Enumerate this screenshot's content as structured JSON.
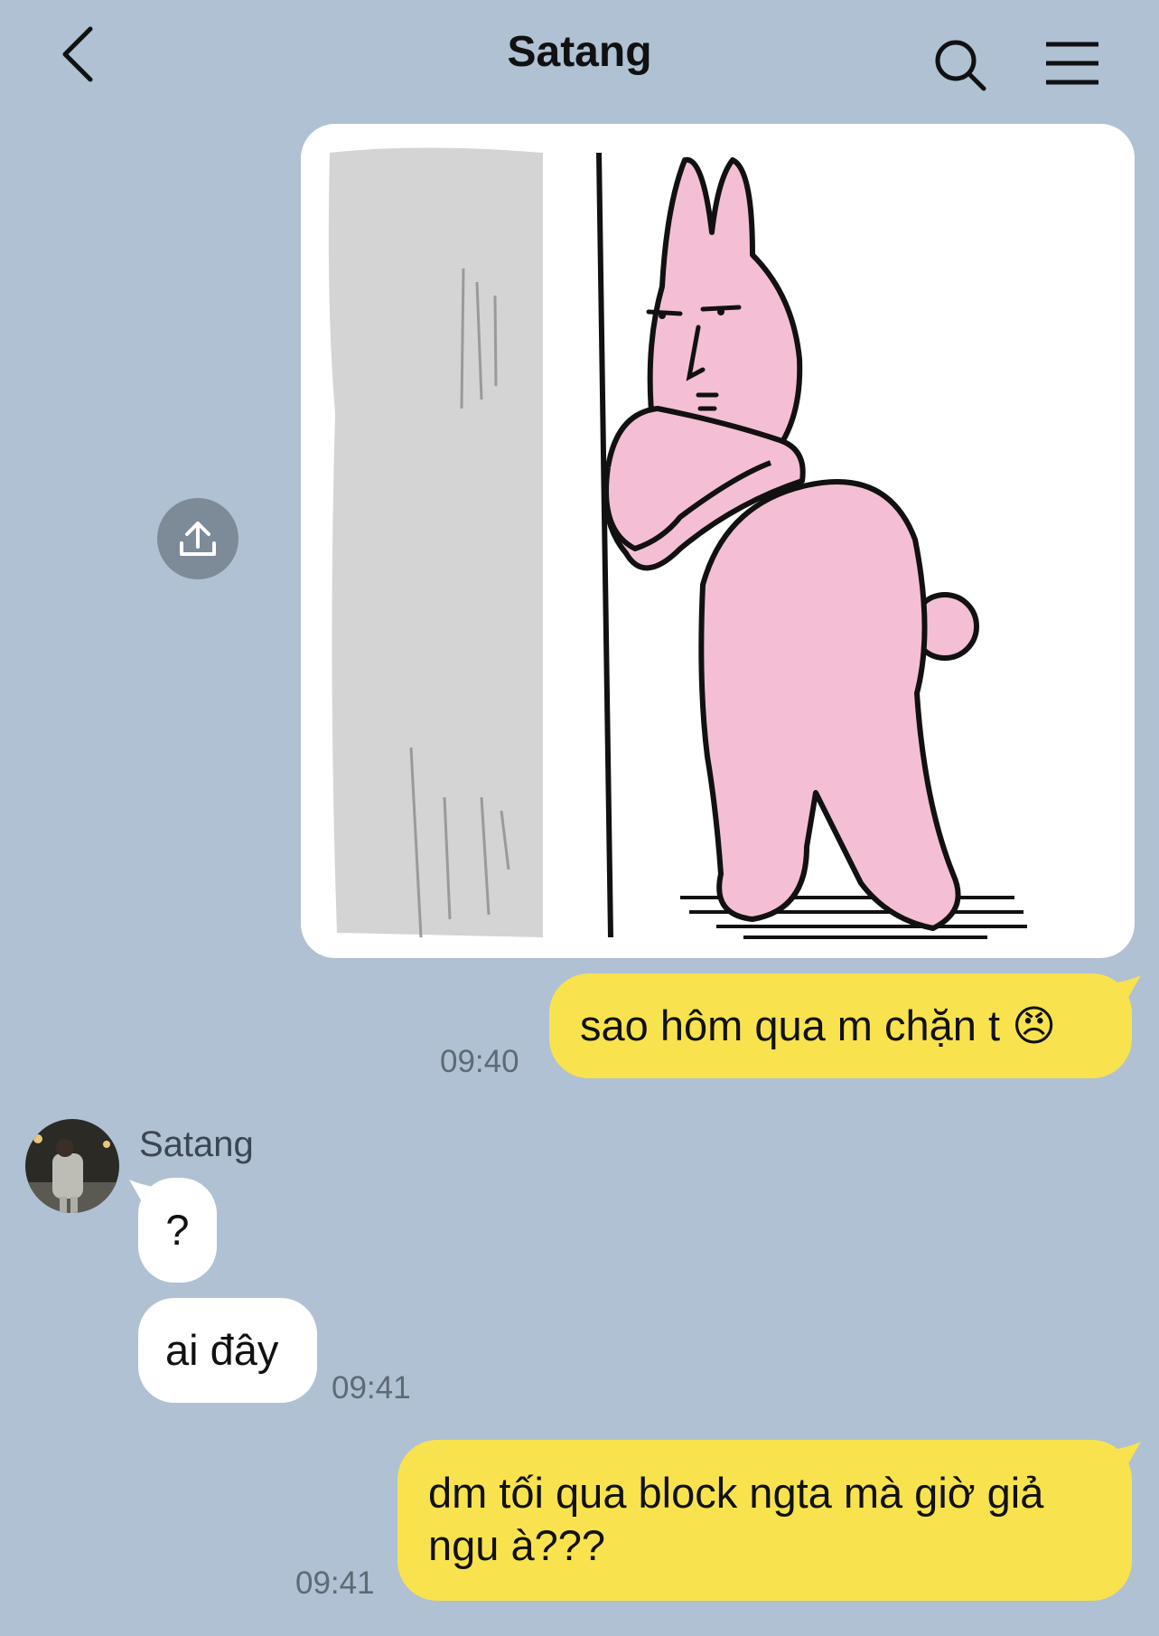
{
  "header": {
    "title": "Satang",
    "back_icon": "chevron-left-icon",
    "search_icon": "search-icon",
    "menu_icon": "hamburger-menu-icon"
  },
  "messages": [
    {
      "type": "sticker",
      "from": "me",
      "description_icon": "pink-rabbit-sticker"
    },
    {
      "type": "text",
      "from": "me",
      "text": "sao hôm qua m chặn t 😠",
      "time": "09:40"
    },
    {
      "type": "sender_label",
      "name": "Satang"
    },
    {
      "type": "text",
      "from": "them",
      "text": "?"
    },
    {
      "type": "text",
      "from": "them",
      "text": "ai đây",
      "time": "09:41"
    },
    {
      "type": "text",
      "from": "me",
      "text": "dm tối qua block ngta mà giờ giả ngu à???",
      "time": "09:41"
    }
  ],
  "colors": {
    "background": "#AFC1D3",
    "my_bubble": "#F8E34E",
    "their_bubble": "#FFFFFF",
    "sticker_pink": "#F4BFD4",
    "share_button": "#7D8A97"
  }
}
